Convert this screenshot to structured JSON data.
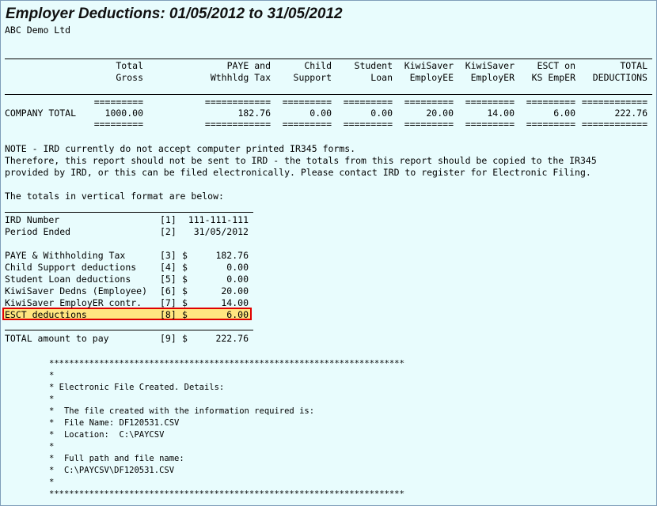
{
  "report": {
    "title": "Employer Deductions: 01/05/2012 to 31/05/2012",
    "company": "ABC Demo Ltd"
  },
  "columns": [
    {
      "line1": "Total",
      "line2": "Gross"
    },
    {
      "line1": "PAYE and",
      "line2": "Wthhldg Tax"
    },
    {
      "line1": "Child",
      "line2": "Support"
    },
    {
      "line1": "Student",
      "line2": "Loan"
    },
    {
      "line1": "KiwiSaver",
      "line2": "EmployEE"
    },
    {
      "line1": "KiwiSaver",
      "line2": "EmployER"
    },
    {
      "line1": "ESCT on",
      "line2": "KS EmpER"
    },
    {
      "line1": "TOTAL",
      "line2": "DEDUCTIONS"
    }
  ],
  "company_total": {
    "label": "COMPANY TOTAL",
    "values": [
      "1000.00",
      "182.76",
      "0.00",
      "0.00",
      "20.00",
      "14.00",
      "6.00",
      "222.76"
    ],
    "rules": [
      "=========",
      "============",
      "=========",
      "=========",
      "=========",
      "=========",
      "=========",
      "============"
    ]
  },
  "notes": [
    "NOTE - IRD currently do not accept computer printed IR345 forms.",
    "Therefore, this report should not be sent to IRD - the totals from this report should be copied to the IR345",
    "provided by IRD, or this can be filed electronically. Please contact IRD to register for Electronic Filing.",
    "",
    "The totals in vertical format are below:"
  ],
  "vertical": [
    {
      "label": "IRD Number",
      "ref": "[1]",
      "cur": "",
      "value": "111-111-111"
    },
    {
      "label": "Period Ended",
      "ref": "[2]",
      "cur": "",
      "value": "31/05/2012"
    },
    {
      "label": "PAYE & Withholding Tax",
      "ref": "[3]",
      "cur": "$",
      "value": "182.76"
    },
    {
      "label": "Child Support deductions",
      "ref": "[4]",
      "cur": "$",
      "value": "0.00"
    },
    {
      "label": "Student Loan deductions",
      "ref": "[5]",
      "cur": "$",
      "value": "0.00"
    },
    {
      "label": "KiwiSaver Dedns (Employee)",
      "ref": "[6]",
      "cur": "$",
      "value": "20.00"
    },
    {
      "label": "KiwiSaver EmployER contr.",
      "ref": "[7]",
      "cur": "$",
      "value": "14.00"
    },
    {
      "label": "ESCT deductions",
      "ref": "[8]",
      "cur": "$",
      "value": "6.00"
    },
    {
      "label": "TOTAL amount to pay",
      "ref": "[9]",
      "cur": "$",
      "value": "222.76"
    }
  ],
  "electronic_box": [
    "**************************************************************************",
    "*                                                                        *",
    "* Electronic File Created. Details:                                      *",
    "*                                                                        *",
    "*  The file created with the information required is:                   *",
    "*  File Name: DF120531.CSV                                               *",
    "*  Location:  C:\\PAYCSV                                                  *",
    "*                                                                        *",
    "*  Full path and file name:                                              *",
    "*  C:\\PAYCSV\\DF120531.CSV                                                *",
    "*                                                                        *",
    "**************************************************************************"
  ],
  "highlight": {
    "color": "#ffe680",
    "border": "#e00000"
  }
}
